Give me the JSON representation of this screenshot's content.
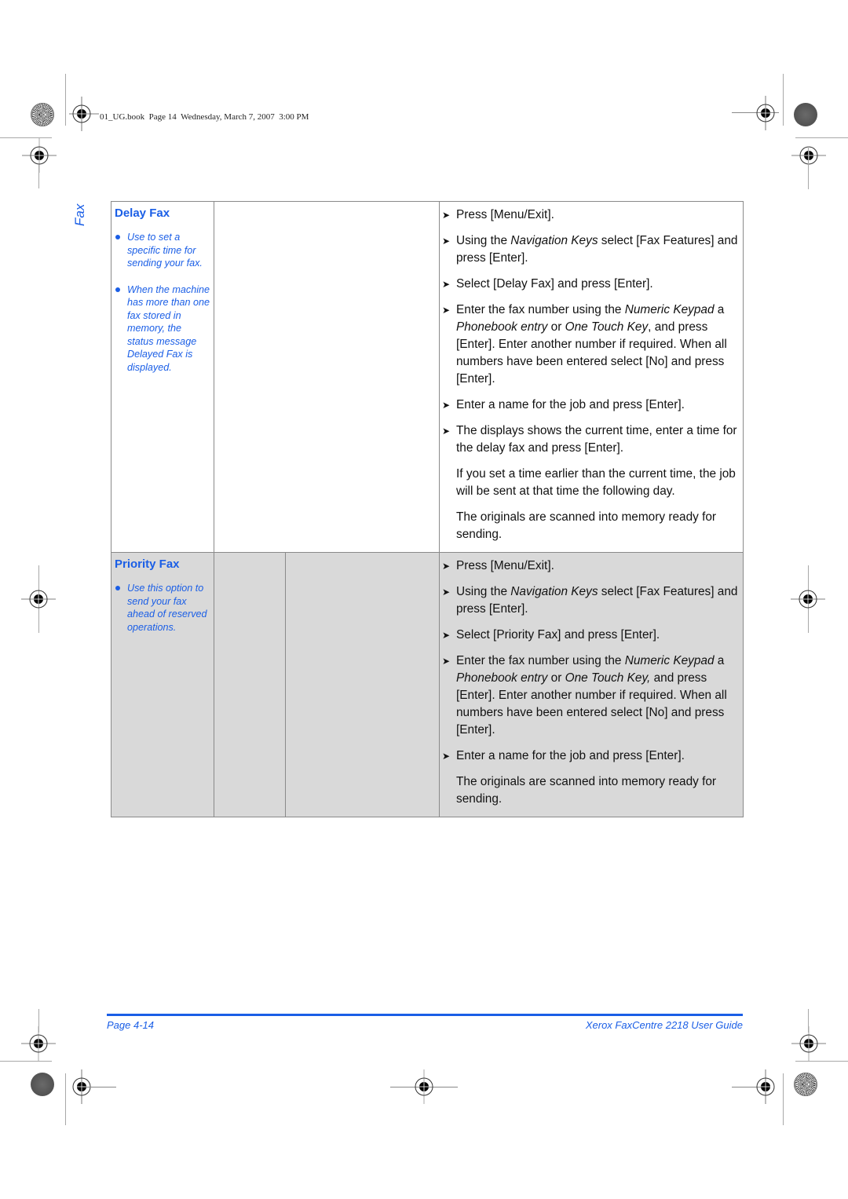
{
  "print_slug": "01_UG.book  Page 14  Wednesday, March 7, 2007  3:00 PM",
  "side_tab": "Fax",
  "features": [
    {
      "title": "Delay Fax",
      "notes": [
        "Use to set a specific time for sending your fax.",
        "When the machine has more than one fax stored in memory, the status message Delayed Fax is displayed."
      ],
      "steps": [
        {
          "type": "step",
          "parts": [
            {
              "t": "Press [Menu/Exit]."
            }
          ]
        },
        {
          "type": "step",
          "parts": [
            {
              "t": "Using the "
            },
            {
              "t": "Navigation Keys",
              "i": true
            },
            {
              "t": " select [Fax Features] and press [Enter]."
            }
          ]
        },
        {
          "type": "step",
          "parts": [
            {
              "t": "Select [Delay Fax] and press [Enter]."
            }
          ]
        },
        {
          "type": "step",
          "parts": [
            {
              "t": "Enter the fax number using the "
            },
            {
              "t": "Numeric Keypad",
              "i": true
            },
            {
              "t": " a "
            },
            {
              "t": "Phonebook entry",
              "i": true
            },
            {
              "t": " or "
            },
            {
              "t": "One Touch Key",
              "i": true
            },
            {
              "t": ", and press [Enter]. Enter another number if required. When all numbers have been entered select [No] and press [Enter]."
            }
          ]
        },
        {
          "type": "step",
          "parts": [
            {
              "t": "Enter a name for the job and press [Enter]."
            }
          ]
        },
        {
          "type": "step",
          "parts": [
            {
              "t": "The displays shows the current time, enter a time for the delay fax and press [Enter]."
            }
          ]
        },
        {
          "type": "note",
          "parts": [
            {
              "t": "If you set a time earlier than the current time, the job will be sent at that time the following day."
            }
          ]
        },
        {
          "type": "note",
          "parts": [
            {
              "t": "The originals are scanned into memory ready for sending."
            }
          ]
        }
      ]
    },
    {
      "title": "Priority Fax",
      "notes": [
        "Use this option to send your fax ahead of reserved operations."
      ],
      "steps": [
        {
          "type": "step",
          "parts": [
            {
              "t": "Press [Menu/Exit]."
            }
          ]
        },
        {
          "type": "step",
          "parts": [
            {
              "t": "Using the "
            },
            {
              "t": "Navigation Keys",
              "i": true
            },
            {
              "t": " select [Fax Features] and press [Enter]."
            }
          ]
        },
        {
          "type": "step",
          "parts": [
            {
              "t": "Select [Priority Fax] and press [Enter]."
            }
          ]
        },
        {
          "type": "step",
          "parts": [
            {
              "t": "Enter the fax number using the "
            },
            {
              "t": "Numeric Keypad",
              "i": true
            },
            {
              "t": " a "
            },
            {
              "t": "Phonebook entry",
              "i": true
            },
            {
              "t": " or "
            },
            {
              "t": "One Touch Key,",
              "i": true
            },
            {
              "t": " and press [Enter]. Enter another number if required. When all numbers have been entered select [No] and press [Enter]."
            }
          ]
        },
        {
          "type": "step",
          "parts": [
            {
              "t": "Enter a name for the job and press [Enter]."
            }
          ]
        },
        {
          "type": "note",
          "parts": [
            {
              "t": "The originals are scanned into memory ready for sending."
            }
          ]
        }
      ]
    }
  ],
  "footer": {
    "page": "Page 4-14",
    "guide": "Xerox FaxCentre 2218 User Guide"
  },
  "colors": {
    "accent": "#1a5ee6",
    "shaded_row": "#d9d9d9",
    "border": "#8a8a8a"
  }
}
